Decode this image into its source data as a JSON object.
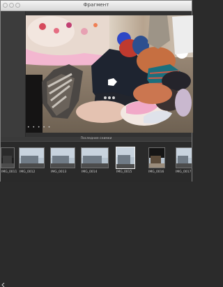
{
  "window": {
    "title": "Фрагмент"
  },
  "sidebar": {
    "status_text": "• • • • •"
  },
  "strip": {
    "label": "Последние снимки",
    "thumbnails": [
      {
        "caption": "IMG_0011"
      },
      {
        "caption": "IMG_0012"
      },
      {
        "caption": "IMG_0013"
      },
      {
        "caption": "IMG_0014"
      },
      {
        "caption": "IMG_0015"
      },
      {
        "caption": "IMG_0016"
      },
      {
        "caption": "IMG_0017"
      }
    ]
  }
}
